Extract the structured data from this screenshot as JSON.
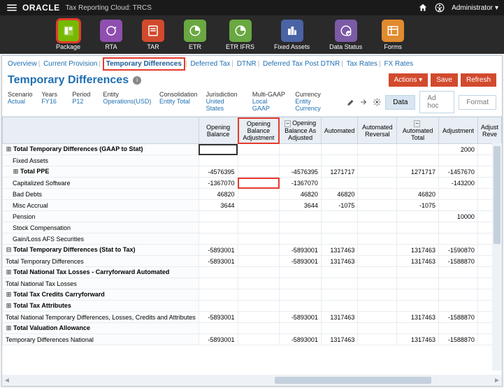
{
  "topbar": {
    "brand": "ORACLE",
    "subtitle": "Tax Reporting Cloud: TRCS",
    "admin_label": "Administrator"
  },
  "nav": [
    {
      "id": "package",
      "label": "Package"
    },
    {
      "id": "rta",
      "label": "RTA"
    },
    {
      "id": "tar",
      "label": "TAR"
    },
    {
      "id": "etr",
      "label": "ETR"
    },
    {
      "id": "etrifrs",
      "label": "ETR IFRS"
    },
    {
      "id": "fixed",
      "label": "Fixed Assets"
    },
    {
      "id": "status",
      "label": "Data Status"
    },
    {
      "id": "forms",
      "label": "Forms"
    }
  ],
  "tabs": {
    "overview": "Overview",
    "current": "Current Provision",
    "tempdiff": "Temporary Differences",
    "deferred": "Deferred Tax",
    "dtnr": "DTNR",
    "defpost": "Deferred Tax Post DTNR",
    "rates": "Tax Rates",
    "fxrates": "FX Rates"
  },
  "page": {
    "title": "Temporary Differences",
    "actions_label": "Actions",
    "save_label": "Save",
    "refresh_label": "Refresh"
  },
  "pov": {
    "scenario_lbl": "Scenario",
    "scenario_val": "Actual",
    "years_lbl": "Years",
    "years_val": "FY16",
    "period_lbl": "Period",
    "period_val": "P12",
    "entity_lbl": "Entity",
    "entity_val": "Operations(USD)",
    "consol_lbl": "Consolidation",
    "consol_val": "Entity Total",
    "juris_lbl": "Jurisdiction",
    "juris_val": "United States",
    "mgaap_lbl": "Multi-GAAP",
    "mgaap_val": "Local GAAP",
    "curr_lbl": "Currency",
    "curr_val": "Entity Currency",
    "tab_data": "Data",
    "tab_adhoc": "Ad hoc",
    "tab_format": "Format"
  },
  "cols": {
    "c1": "Opening Balance",
    "c2": "Opening Balance Adjustment",
    "c3": "Opening Balance As Adjusted",
    "c4": "Automated",
    "c5": "Automated Reversal",
    "c6": "Automated Total",
    "c7": "Adjustment",
    "c8": "Adjust Reve"
  },
  "rows": [
    {
      "label": "Total Temporary Differences (GAAP to Stat)",
      "exp": "+",
      "bold": true,
      "c7": "2000"
    },
    {
      "label": "Fixed Assets",
      "indent": 1
    },
    {
      "label": "Total PPE",
      "exp": "+",
      "bold": true,
      "indent": 1,
      "c1": "-4576395",
      "c3": "-4576395",
      "c4": "1271717",
      "c6": "1271717",
      "c7": "-1457670"
    },
    {
      "label": "Capitalized Software",
      "indent": 1,
      "c1": "-1367070",
      "c3": "-1367070",
      "c7": "-143200",
      "hl_c2": true
    },
    {
      "label": "Bad Debts",
      "indent": 1,
      "c1": "46820",
      "c3": "46820",
      "c4": "46820",
      "c6": "46820"
    },
    {
      "label": "Misc Accrual",
      "indent": 1,
      "c1": "3644",
      "c3": "3644",
      "c4": "-1075",
      "c6": "-1075"
    },
    {
      "label": "Pension",
      "indent": 1,
      "c7": "10000"
    },
    {
      "label": "Stock Compensation",
      "indent": 1
    },
    {
      "label": "Gain/Loss AFS Securities",
      "indent": 1
    },
    {
      "label": "Total Temporary Differences (Stat to Tax)",
      "exp": "−",
      "bold": true,
      "c1": "-5893001",
      "c3": "-5893001",
      "c4": "1317463",
      "c6": "1317463",
      "c7": "-1590870"
    },
    {
      "label": "Total Temporary Differences",
      "c1": "-5893001",
      "c3": "-5893001",
      "c4": "1317463",
      "c6": "1317463",
      "c7": "-1588870"
    },
    {
      "label": "Total National Tax Losses - Carryforward Automated",
      "exp": "+",
      "bold": true
    },
    {
      "label": "Total National Tax Losses"
    },
    {
      "label": "Total Tax Credits Carryforward",
      "exp": "+",
      "bold": true
    },
    {
      "label": "Total Tax Attributes",
      "exp": "+",
      "bold": true
    },
    {
      "label": "Total National Temporary Differences, Losses, Credits and Attributes",
      "c1": "-5893001",
      "c3": "-5893001",
      "c4": "1317463",
      "c6": "1317463",
      "c7": "-1588870"
    },
    {
      "label": "Total Valuation Allowance",
      "exp": "+",
      "bold": true
    },
    {
      "label": "Temporary Differences National",
      "c1": "-5893001",
      "c3": "-5893001",
      "c4": "1317463",
      "c6": "1317463",
      "c7": "-1588870"
    }
  ]
}
